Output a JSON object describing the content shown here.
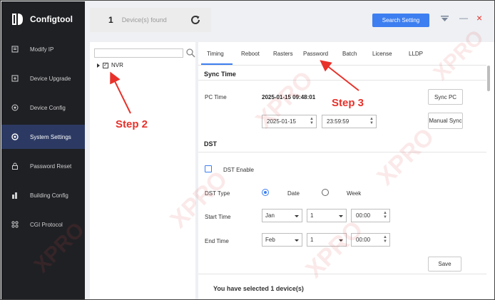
{
  "app": {
    "name": "Configtool"
  },
  "devices": {
    "count": "1",
    "label": "Device(s) found"
  },
  "toolbar": {
    "search_setting": "Search Setting"
  },
  "sidebar": {
    "items": [
      {
        "label": "Modify IP",
        "icon": "modify-ip-icon"
      },
      {
        "label": "Device Upgrade",
        "icon": "upgrade-icon"
      },
      {
        "label": "Device Config",
        "icon": "device-config-icon"
      },
      {
        "label": "System Settings",
        "icon": "system-settings-icon",
        "active": true
      },
      {
        "label": "Password Reset",
        "icon": "lock-icon"
      },
      {
        "label": "Building Config",
        "icon": "building-icon"
      },
      {
        "label": "CGI Protocol",
        "icon": "cgi-icon"
      }
    ]
  },
  "tree": {
    "root_label": "NVR",
    "checked": true
  },
  "tabs": [
    "Timing",
    "Reboot",
    "Rasters",
    "Password",
    "Batch",
    "License",
    "LLDP"
  ],
  "sync": {
    "title": "Sync Time",
    "pc_time_label": "PC Time",
    "pc_time_value": "2025-01-15 09:48:01",
    "sync_pc_button": "Sync PC",
    "date_value": "2025-01-15",
    "time_value": "23:59:59",
    "manual_sync_button": "Manual Sync"
  },
  "dst": {
    "title": "DST",
    "enable_label": "DST Enable",
    "type_label": "DST Type",
    "type_date": "Date",
    "type_week": "Week",
    "start_label": "Start Time",
    "start_month": "Jan",
    "start_day": "1",
    "start_time": "00:00",
    "end_label": "End Time",
    "end_month": "Feb",
    "end_day": "1",
    "end_time": "00:00",
    "save_button": "Save"
  },
  "footer": {
    "selection_text": "You have selected 1 device(s)"
  },
  "annotations": {
    "step2": "Step 2",
    "step3": "Step 3"
  },
  "colors": {
    "accent": "#3d7ff0",
    "sidebar_bg": "#1f2024",
    "sidebar_active": "#2c3a63",
    "annotation": "#e8312a"
  }
}
